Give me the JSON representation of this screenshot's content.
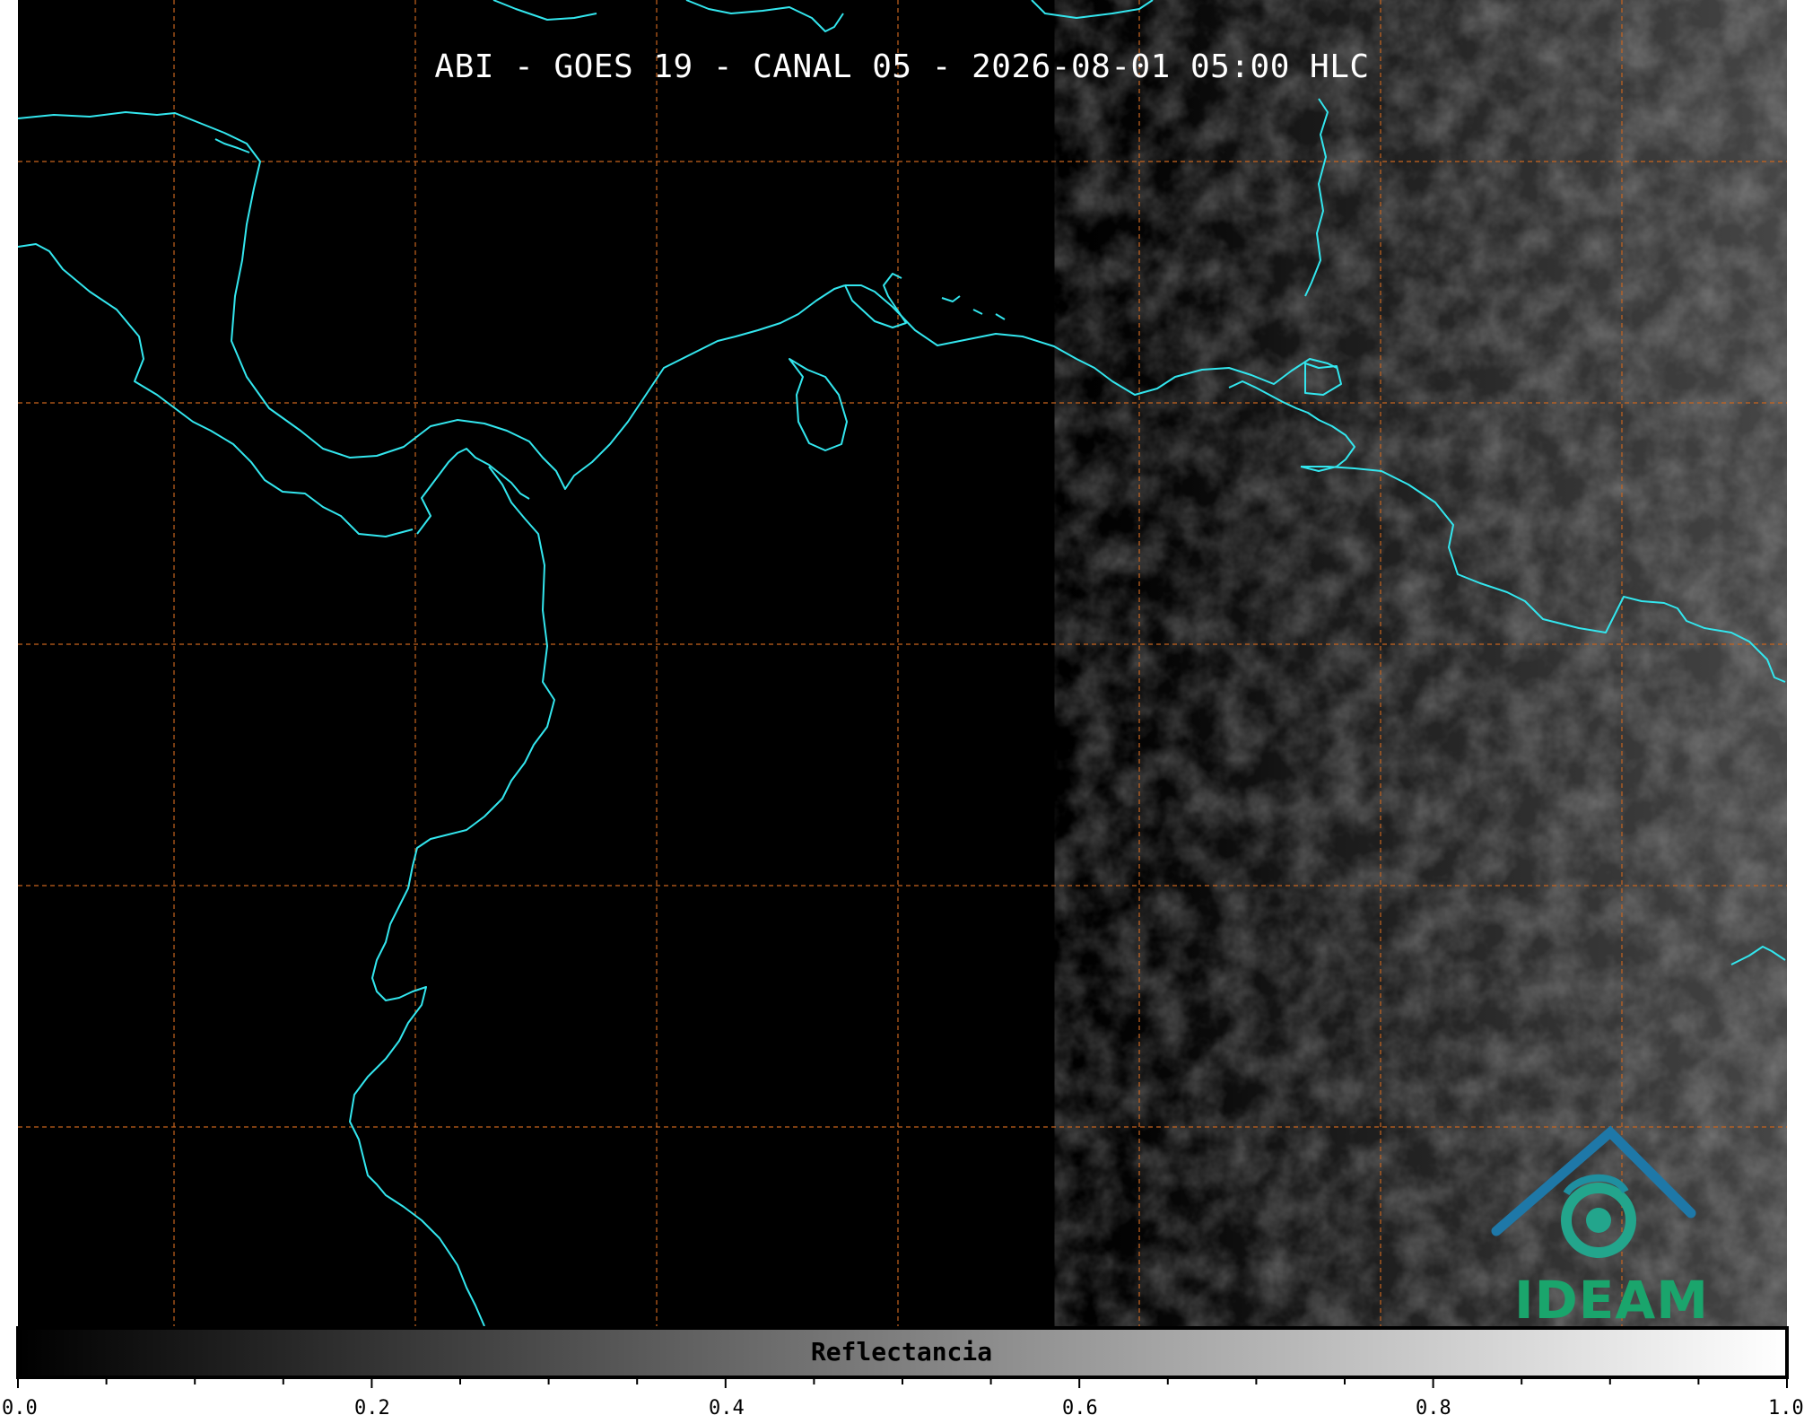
{
  "header": {
    "title": "ABI - GOES 19 - CANAL 05 - 2026-08-01 05:00 HLC"
  },
  "map": {
    "background_color": "#000000",
    "coastline_color": "#33e6ee",
    "gridline_color": "#c8641e",
    "gridline_style": "dashed",
    "cloud_shading": "grey reflectance increasing toward the east"
  },
  "colorbar": {
    "label": "Reflectancia",
    "colormap": "greys (black to white)",
    "range": [
      0.0,
      1.0
    ],
    "tick_labels": [
      "0.0",
      "0.2",
      "0.4",
      "0.6",
      "0.8",
      "1.0"
    ]
  },
  "logo": {
    "name": "IDEAM",
    "icon": "ideam-mountain-swirl-icon"
  }
}
